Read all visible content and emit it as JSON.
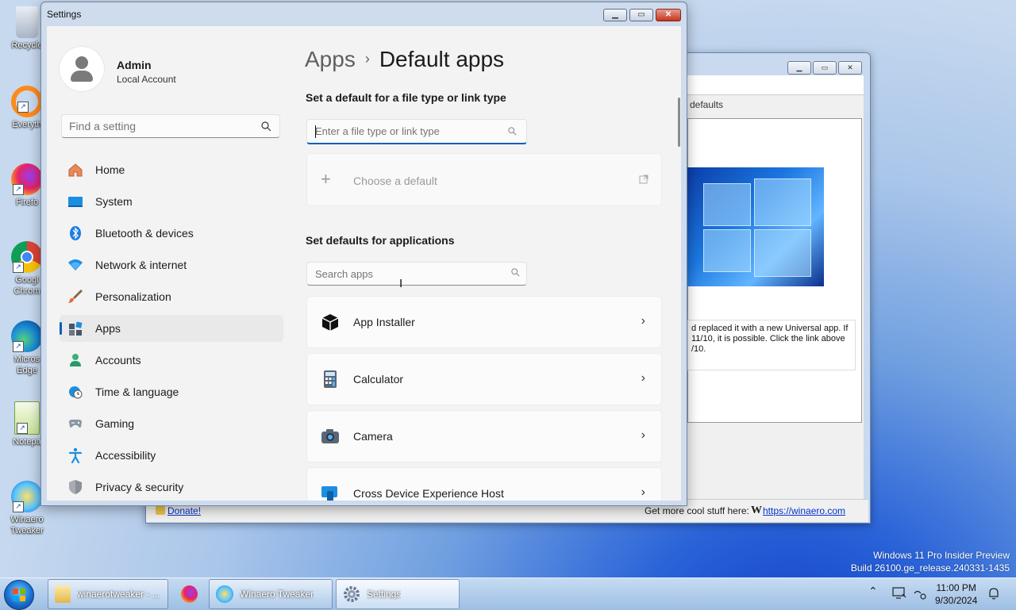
{
  "desktop": {
    "icons": [
      {
        "label": "Recycle"
      },
      {
        "label": "Everyth"
      },
      {
        "label": "Firefo"
      },
      {
        "label": "Googl Chrom"
      },
      {
        "label": "Micros Edge"
      },
      {
        "label": "Notepa"
      },
      {
        "label": "Winaero Tweaker"
      }
    ],
    "watermark": {
      "line1": "Windows 11 Pro Insider Preview",
      "line2": "Build 26100.ge_release.240331-1435"
    }
  },
  "bg_window": {
    "defaults_label": "defaults",
    "text": "d replaced it with a new Universal app. If 11/10, it is possible. Click the link above /10.",
    "status_donate": "Donate!",
    "status_more": "Get more cool stuff here:",
    "status_w": "W",
    "status_link": "https://winaero.com"
  },
  "settings": {
    "window_title": "Settings",
    "user": {
      "name": "Admin",
      "type": "Local Account"
    },
    "find_placeholder": "Find a setting",
    "nav": [
      {
        "label": "Home",
        "icon": "home-icon"
      },
      {
        "label": "System",
        "icon": "system-icon"
      },
      {
        "label": "Bluetooth & devices",
        "icon": "bluetooth-icon"
      },
      {
        "label": "Network & internet",
        "icon": "wifi-icon"
      },
      {
        "label": "Personalization",
        "icon": "brush-icon"
      },
      {
        "label": "Apps",
        "icon": "apps-icon"
      },
      {
        "label": "Accounts",
        "icon": "person-icon"
      },
      {
        "label": "Time & language",
        "icon": "clock-globe-icon"
      },
      {
        "label": "Gaming",
        "icon": "gamepad-icon"
      },
      {
        "label": "Accessibility",
        "icon": "accessibility-icon"
      },
      {
        "label": "Privacy & security",
        "icon": "shield-icon"
      }
    ],
    "selected_nav": "Apps",
    "breadcrumb": {
      "parent": "Apps",
      "sep": "›",
      "current": "Default apps"
    },
    "file_type_heading": "Set a default for a file type or link type",
    "file_type_placeholder": "Enter a file type or link type",
    "choose_default": "Choose a default",
    "apps_heading": "Set defaults for applications",
    "search_apps_placeholder": "Search apps",
    "apps": [
      {
        "label": "App Installer",
        "icon": "app-installer-icon"
      },
      {
        "label": "Calculator",
        "icon": "calculator-icon"
      },
      {
        "label": "Camera",
        "icon": "camera-icon"
      },
      {
        "label": "Cross Device Experience Host",
        "icon": "cross-device-icon"
      }
    ],
    "chevron": "›"
  },
  "taskbar": {
    "buttons": [
      {
        "label": "winaerotweaker - ..."
      },
      {
        "label": ""
      },
      {
        "label": "Winaero Tweaker"
      },
      {
        "label": "Settings"
      }
    ],
    "clock": {
      "time": "11:00 PM",
      "date": "9/30/2024"
    }
  },
  "colors": {
    "accent": "#005fb8",
    "close": "#c6341c"
  }
}
